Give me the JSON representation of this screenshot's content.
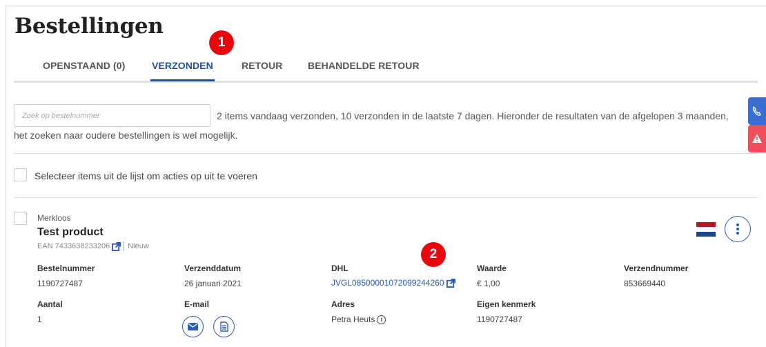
{
  "page": {
    "title": "Bestellingen"
  },
  "tabs": [
    {
      "label": "OPENSTAAND (0)",
      "active": false
    },
    {
      "label": "VERZONDEN",
      "active": true
    },
    {
      "label": "RETOUR",
      "active": false
    },
    {
      "label": "BEHANDELDE RETOUR",
      "active": false
    }
  ],
  "markers": {
    "one": "1",
    "two": "2"
  },
  "search": {
    "placeholder": "Zoek op bestelnummer",
    "value": ""
  },
  "info": {
    "line1": "2 items vandaag verzonden, 10 verzonden in de laatste 7 dagen. Hieronder de resultaten van de afgelopen 3 maanden,",
    "line2": "het zoeken naar oudere bestellingen is wel mogelijk."
  },
  "bulk": {
    "label": "Selecteer items uit de lijst om acties op uit te voeren"
  },
  "order": {
    "brand": "Merkloos",
    "product": "Test product",
    "ean": "EAN 7433638233206",
    "condition": "Nieuw",
    "flag_colors": [
      "#ae1c28",
      "#ffffff",
      "#21468b"
    ],
    "fields": {
      "bestelnummer": {
        "label": "Bestelnummer",
        "value": "1190727487"
      },
      "verzenddatum": {
        "label": "Verzenddatum",
        "value": "26 januari 2021"
      },
      "carrier": {
        "label": "DHL",
        "value": "JVGL08500001072099244260"
      },
      "waarde": {
        "label": "Waarde",
        "value": "€ 1,00"
      },
      "verzendnummer": {
        "label": "Verzendnummer",
        "value": "853669440"
      },
      "aantal": {
        "label": "Aantal",
        "value": "1"
      },
      "email": {
        "label": "E-mail"
      },
      "adres": {
        "label": "Adres",
        "value": "Petra Heuts"
      },
      "eigen_kenmerk": {
        "label": "Eigen kenmerk",
        "value": "1190727487"
      }
    }
  },
  "colors": {
    "accent": "#1f4fa8",
    "marker": "#e8070f",
    "side_blue": "#3a6fd0",
    "side_red": "#ef4f5b"
  }
}
